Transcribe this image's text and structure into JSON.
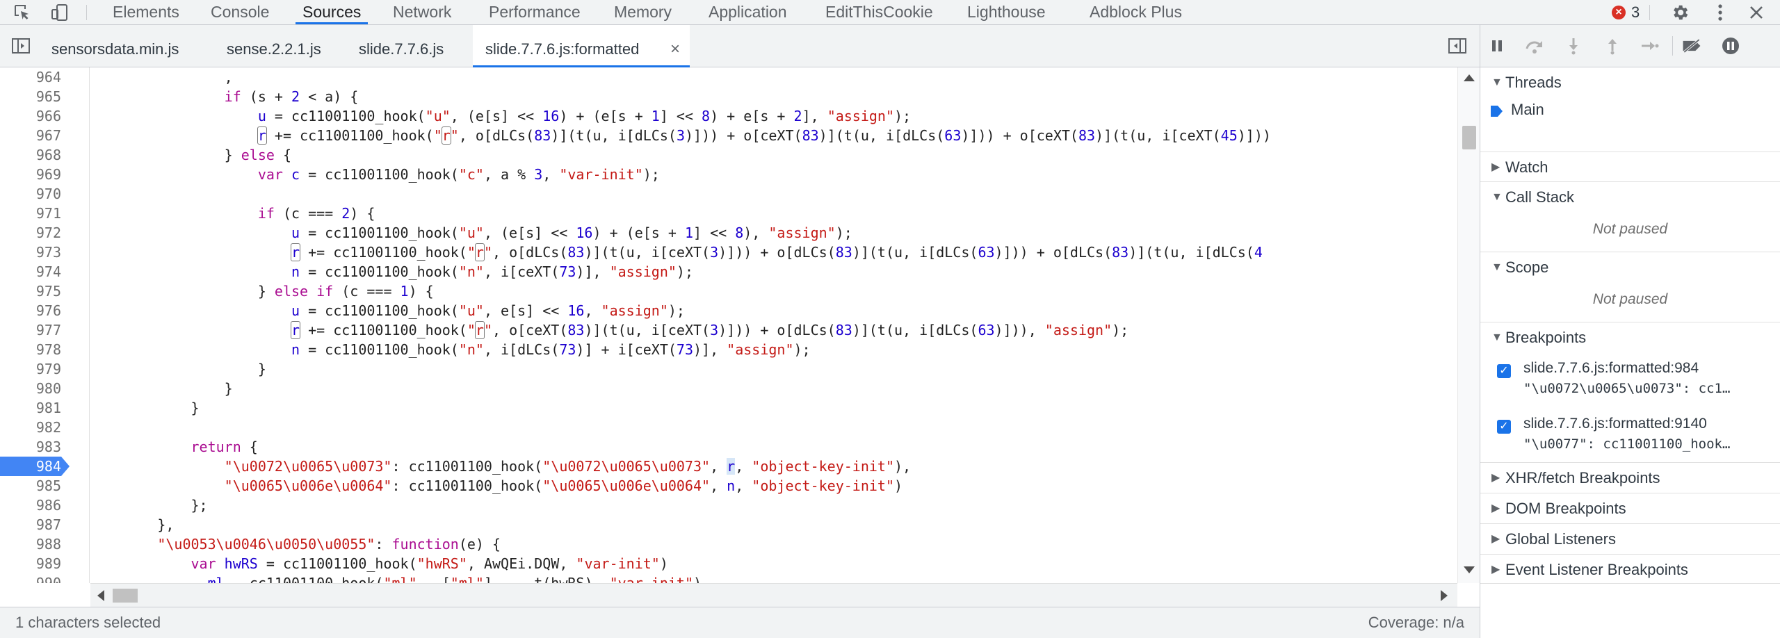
{
  "toolbar": {
    "tabs": [
      "Elements",
      "Console",
      "Sources",
      "Network",
      "Performance",
      "Memory",
      "Application",
      "EditThisCookie",
      "Lighthouse",
      "Adblock Plus"
    ],
    "active_tab": "Sources",
    "error_count": "3",
    "error_color": "#d93025",
    "accent_color": "#1a73e8"
  },
  "file_tabs": [
    {
      "label": "sensorsdata.min.js"
    },
    {
      "label": "sense.2.2.1.js"
    },
    {
      "label": "slide.7.7.6.js"
    },
    {
      "label": "slide.7.7.6.js:formatted",
      "active": true,
      "close_label": "×"
    }
  ],
  "editor": {
    "breakpoint_line": "984",
    "lines": [
      {
        "n": "964"
      },
      {
        "n": "965"
      },
      {
        "n": "966"
      },
      {
        "n": "967"
      },
      {
        "n": "968"
      },
      {
        "n": "969"
      },
      {
        "n": "970"
      },
      {
        "n": "971"
      },
      {
        "n": "972"
      },
      {
        "n": "973"
      },
      {
        "n": "974"
      },
      {
        "n": "975"
      },
      {
        "n": "976"
      },
      {
        "n": "977"
      },
      {
        "n": "978"
      },
      {
        "n": "979"
      },
      {
        "n": "980"
      },
      {
        "n": "981"
      },
      {
        "n": "982"
      },
      {
        "n": "983"
      },
      {
        "n": "984"
      },
      {
        "n": "985"
      },
      {
        "n": "986"
      },
      {
        "n": "987"
      },
      {
        "n": "988"
      },
      {
        "n": "989"
      },
      {
        "n": "990"
      }
    ]
  },
  "status": {
    "selection": "1 characters selected",
    "coverage": "Coverage: n/a"
  },
  "sidebar": {
    "threads_label": "Threads",
    "main_thread": "Main",
    "watch_label": "Watch",
    "call_stack_label": "Call Stack",
    "call_stack_empty": "Not paused",
    "scope_label": "Scope",
    "scope_empty": "Not paused",
    "breakpoints_label": "Breakpoints",
    "breakpoints": [
      {
        "location": "slide.7.7.6.js:formatted:984",
        "code": "\"\\u0072\\u0065\\u0073\": cc1…"
      },
      {
        "location": "slide.7.7.6.js:formatted:9140",
        "code": "\"\\u0077\": cc11001100_hook…"
      }
    ],
    "xhr_label": "XHR/fetch Breakpoints",
    "dom_label": "DOM Breakpoints",
    "global_label": "Global Listeners",
    "event_label": "Event Listener Breakpoints"
  }
}
